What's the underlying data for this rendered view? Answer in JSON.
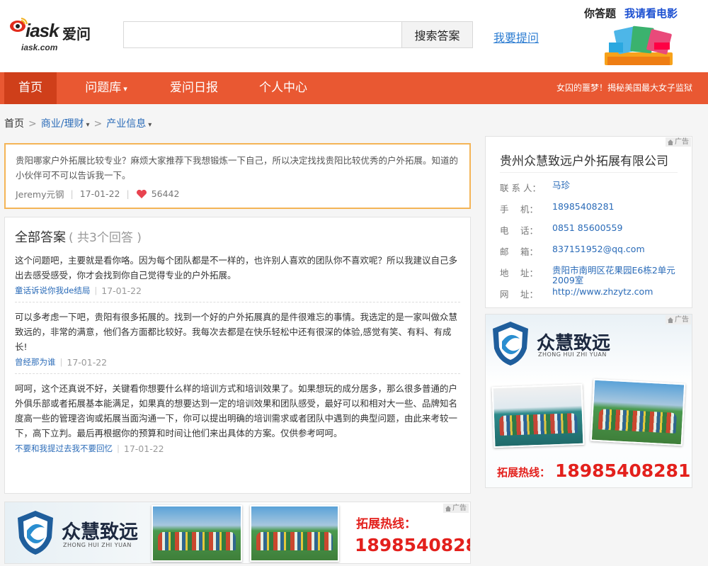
{
  "header": {
    "logo": {
      "brand": "iask",
      "brand_cn": "爱问",
      "domain": "iask.com"
    },
    "search": {
      "value": "",
      "placeholder": "",
      "button_label": "搜索答案"
    },
    "ask_link": "我要提问",
    "promo": {
      "text1": "你答题",
      "text2": "我请看电影"
    }
  },
  "nav": {
    "items": [
      {
        "label": "首页",
        "active": true
      },
      {
        "label": "问题库",
        "dropdown": true
      },
      {
        "label": "爱问日报"
      },
      {
        "label": "个人中心"
      }
    ],
    "banner_text": "女囚的噩梦！揭秘美国最大女子监狱"
  },
  "breadcrumb": {
    "home": "首页",
    "level1": "商业/理财",
    "level2": "产业信息"
  },
  "question": {
    "text": "贵阳哪家户外拓展比较专业？麻烦大家推荐下我想锻炼一下自己，所以决定找找贵阳比较优秀的户外拓展。知道的小伙伴可不可以告诉我一下。",
    "author": "Jeremy元钢",
    "date": "17-01-22",
    "likes": "56442"
  },
  "answers": {
    "title": "全部答案",
    "count_text": "( 共3个回答 )",
    "items": [
      {
        "text": "这个问题吧，主要就是看你咯。因为每个团队都是不一样的，也许别人喜欢的团队你不喜欢呢？所以我建议自己多出去感受感受，你才会找到你自己觉得专业的户外拓展。",
        "author": "童话诉说你我de结局",
        "date": "17-01-22"
      },
      {
        "text": "可以多考虑一下吧，贵阳有很多拓展的。找到一个好的户外拓展真的是件很难忘的事情。我选定的是一家叫做众慧致远的，非常的满意，他们各方面都比较好。我每次去都是在快乐轻松中还有很深的体验,感觉有笑、有料、有成长!",
        "author": "曾经那为谁",
        "date": "17-01-22"
      },
      {
        "text": "呵呵，这个还真说不好，关键看你想要什么样的培训方式和培训效果了。如果想玩的成分居多，那么很多普通的户外俱乐部或者拓展基本能满足，如果真的想要达到一定的培训效果和团队感受，最好可以和相对大一些、品牌知名度高一些的管理咨询或拓展当面沟通一下，你可以提出明确的培训需求或者团队中遇到的典型问题，由此来考较一下，高下立判。最后再根据你的预算和时间让他们来出具体的方案。仅供参考呵呵。",
        "author": "不要和我提过去我不要回忆",
        "date": "17-01-22"
      }
    ]
  },
  "ad_tag": "广告",
  "company": {
    "name": "贵州众慧致远户外拓展有限公司",
    "rows": [
      {
        "label": "联 系 人：",
        "value": "马珍"
      },
      {
        "label": "手　 机：",
        "value": "18985408281"
      },
      {
        "label": "电　 话：",
        "value": "0851 85600559"
      },
      {
        "label": "邮　 箱：",
        "value": "837151952@qq.com"
      },
      {
        "label": "地　 址：",
        "value": "贵阳市南明区花果园E6栋2单元2009室"
      },
      {
        "label": "网　 址：",
        "value": "http://www.zhzytz.com"
      }
    ]
  },
  "ad": {
    "brand": "众慧致远",
    "pinyin": "ZHONG HUI ZHI YUAN",
    "hotline_label": "拓展热线：",
    "hotline_number": "18985408281"
  },
  "colors": {
    "nav_bg": "#e95832",
    "nav_active": "#cf3f1a",
    "link": "#2a6bb8",
    "question_border": "#f4b456",
    "hotline": "#e3201c"
  }
}
